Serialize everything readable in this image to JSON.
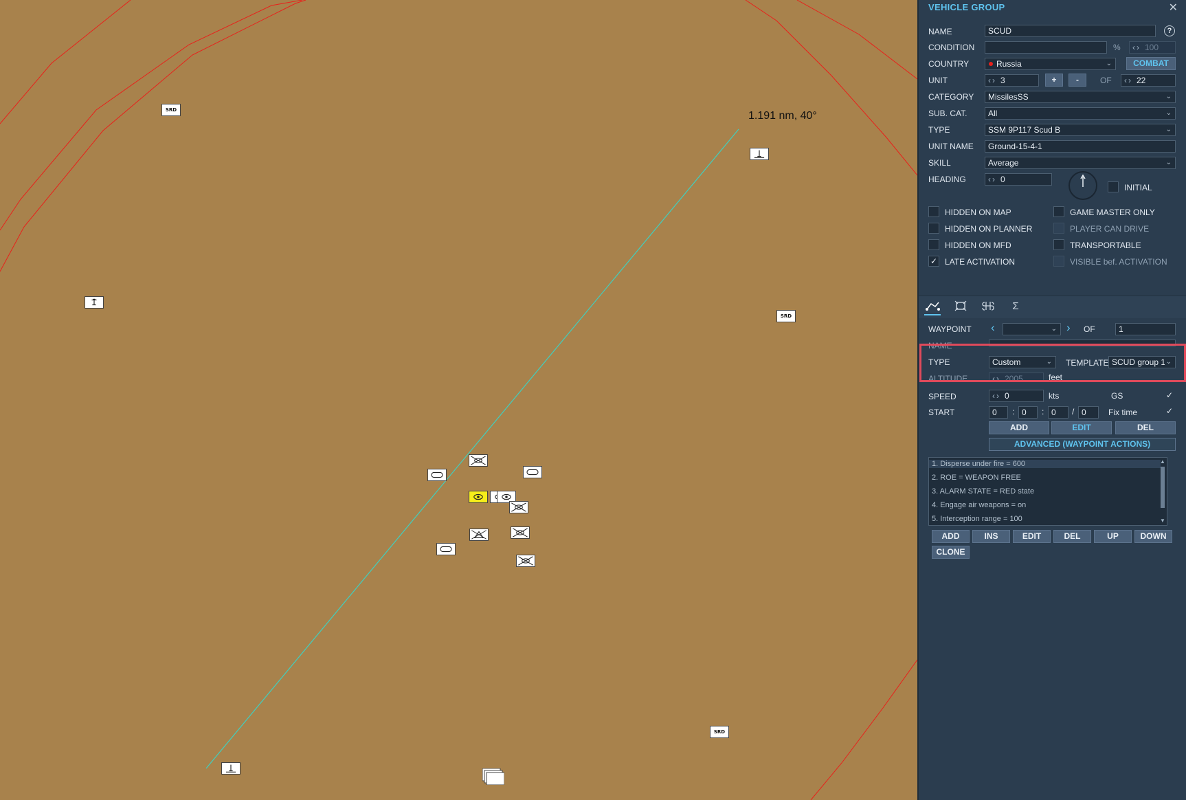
{
  "map": {
    "measure_label": "1.191 nm, 40°",
    "colors": {
      "terrain": "#a8824c",
      "boundary": "#e8211b",
      "measure_line": "#3fd0c0",
      "selected_unit": "#f6ee1a"
    },
    "icons": {
      "srd_label": "SRD"
    }
  },
  "panel": {
    "title": "VEHICLE GROUP",
    "close_glyph": "✕",
    "help_glyph": "?",
    "name": {
      "label": "NAME",
      "value": "SCUD"
    },
    "condition": {
      "label": "CONDITION",
      "unit": "%",
      "value": "100"
    },
    "country": {
      "label": "COUNTRY",
      "value": "Russia",
      "combat_label": "COMBAT"
    },
    "unit": {
      "label": "UNIT",
      "value": "3",
      "plus": "+",
      "minus": "-",
      "of_label": "OF",
      "total": "22"
    },
    "category": {
      "label": "CATEGORY",
      "value": "MissilesSS"
    },
    "subcat": {
      "label": "SUB. CAT.",
      "value": "All"
    },
    "type": {
      "label": "TYPE",
      "value": "SSM 9P117 Scud B"
    },
    "unit_name": {
      "label": "UNIT NAME",
      "value": "Ground-15-4-1"
    },
    "skill": {
      "label": "SKILL",
      "value": "Average"
    },
    "heading": {
      "label": "HEADING",
      "value": "0",
      "initial_label": "INITIAL"
    },
    "checkboxes": {
      "hidden_on_map": "HIDDEN ON MAP",
      "game_master_only": "GAME MASTER ONLY",
      "hidden_on_planner": "HIDDEN ON PLANNER",
      "player_can_drive": "PLAYER CAN DRIVE",
      "hidden_on_mfd": "HIDDEN ON MFD",
      "transportable": "TRANSPORTABLE",
      "late_activation": "LATE ACTIVATION",
      "visible_bef_activation": "VISIBLE bef. ACTIVATION",
      "check_glyph": "✓"
    },
    "waypoint": {
      "label": "WAYPOINT",
      "of_label": "OF",
      "total": "1",
      "name_label": "NAME",
      "type_label": "TYPE",
      "type_value": "Custom",
      "template_label": "TEMPLATE",
      "template_value": "SCUD group 1",
      "altitude_label": "ALTITUDE",
      "altitude_value": "2005",
      "altitude_unit": "feet",
      "speed_label": "SPEED",
      "speed_value": "0",
      "speed_unit": "kts",
      "gs_label": "GS",
      "start_label": "START",
      "start_d": "0",
      "start_h": "0",
      "start_m": "0",
      "start_s": "0",
      "colon": ":",
      "slash": "/",
      "fix_time_label": "Fix time",
      "add": "ADD",
      "edit": "EDIT",
      "del": "DEL",
      "advanced": "ADVANCED (WAYPOINT ACTIONS)"
    },
    "actions": [
      "1. Disperse under fire = 600",
      "2. ROE = WEAPON FREE",
      "3. ALARM STATE = RED state",
      "4. Engage air weapons = on",
      "5. Interception range = 100"
    ],
    "action_buttons": {
      "add": "ADD",
      "ins": "INS",
      "edit": "EDIT",
      "del": "DEL",
      "up": "UP",
      "down": "DOWN",
      "clone": "CLONE"
    },
    "colors": {
      "panel_bg": "#2b3d4f",
      "accent": "#5fc3ee",
      "highlight_border": "#e04a5b"
    }
  }
}
